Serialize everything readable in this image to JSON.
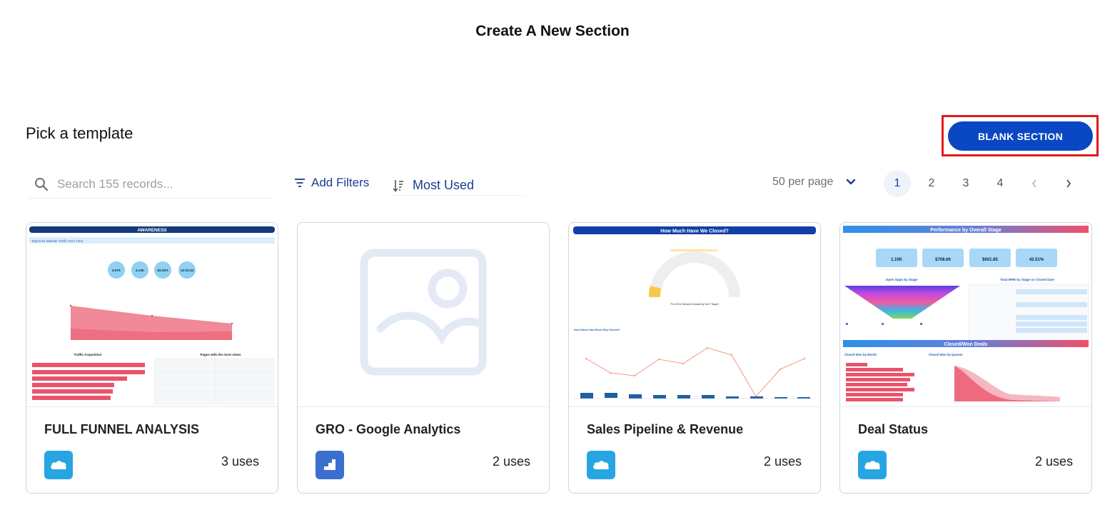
{
  "header": {
    "title": "Create A New Section"
  },
  "templates_section": {
    "heading": "Pick a template",
    "blank_button": "BLANK SECTION"
  },
  "toolbar": {
    "search_placeholder": "Search 155 records...",
    "filters_label": "Add Filters",
    "sort_label": "Most Used",
    "per_page_label": "50 per page"
  },
  "pagination": {
    "pages": [
      "1",
      "2",
      "3",
      "4"
    ],
    "current": "1"
  },
  "cards": [
    {
      "title": "FULL FUNNEL ANALYSIS",
      "uses": "3 uses",
      "source_icon": "salesforce-icon",
      "thumb": {
        "banner": "AWARENESS",
        "subtitle": "TapClicks Website Traffic Over Time",
        "kpis": [
          "5.57K",
          "4.13K",
          "83.03%",
          "12:15:43"
        ],
        "left_title": "Traffic Acquisition",
        "right_title": "Pages with the most views"
      }
    },
    {
      "title": "GRO - Google Analytics",
      "uses": "2 uses",
      "source_icon": "google-analytics-icon",
      "thumb": {}
    },
    {
      "title": "Sales Pipeline & Revenue",
      "uses": "2 uses",
      "source_icon": "salesforce-icon",
      "thumb": {
        "banner": "How Much Have We Closed?",
        "gauge_caption": "Pct 2024 Ramped Quarterly NLE Target",
        "section2": "How Much Has Each Rep Closed?"
      }
    },
    {
      "title": "Deal Status",
      "uses": "2 uses",
      "source_icon": "salesforce-icon",
      "thumb": {
        "banner": "Performance by Overall Stage",
        "kpis": [
          "1.10K",
          "$708.66",
          "$601.85",
          "42.51%"
        ],
        "left_title": "Open Opps by Stage",
        "right_title": "Total MRR by Stage on Closed Date",
        "banner2": "Closed/Won Deals",
        "chart_left": "Closed Won by Month",
        "chart_right": "Closed Won by Quarter"
      }
    }
  ],
  "colors": {
    "primary": "#0a47c2",
    "highlight": "#e01b1b",
    "link": "#1a3d8f",
    "salesforce": "#27a5e3",
    "ga": "#3a6fd0",
    "card_border": "#c8d6e5"
  }
}
